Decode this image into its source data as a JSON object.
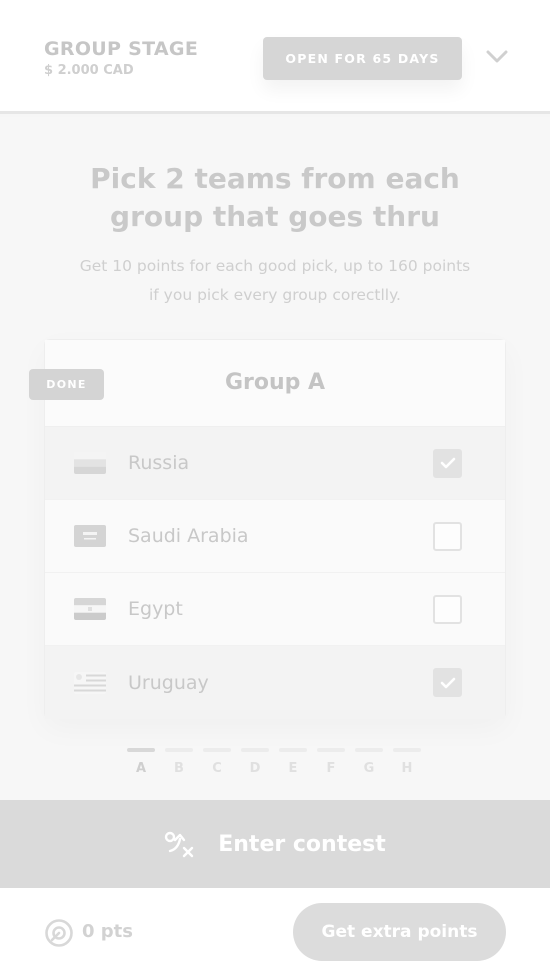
{
  "header": {
    "title": "GROUP STAGE",
    "prize": "$ 2.000 CAD",
    "status": "OPEN FOR 65 DAYS"
  },
  "intro": {
    "headline_line1": "Pick 2 teams from each",
    "headline_line2": "group that goes thru",
    "subtext_line1": "Get 10 points for each good pick, up to 160 points",
    "subtext_line2": "if you pick every group corectlly."
  },
  "group": {
    "badge": "DONE",
    "title": "Group A",
    "teams": [
      {
        "name": "Russia",
        "selected": true
      },
      {
        "name": "Saudi Arabia",
        "selected": false
      },
      {
        "name": "Egypt",
        "selected": false
      },
      {
        "name": "Uruguay",
        "selected": true
      }
    ]
  },
  "pager": {
    "labels": [
      "A",
      "B",
      "C",
      "D",
      "E",
      "F",
      "G",
      "H"
    ],
    "active": "A"
  },
  "actions": {
    "enter_label": "Enter contest",
    "points_label": "0 pts",
    "extra_label": "Get extra points"
  },
  "icons": {
    "chevron": "chevron-down-icon",
    "enter": "strategy-icon",
    "points": "target-icon",
    "check": "check-icon"
  },
  "colors": {
    "accent": "#d6d6d6",
    "text_muted": "#c6c6c6",
    "background": "#f7f7f7"
  }
}
